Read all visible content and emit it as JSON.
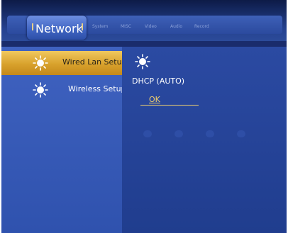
{
  "tabs": [
    {
      "label": "Network",
      "active": true
    },
    {
      "label": "System",
      "active": false
    },
    {
      "label": "MISC",
      "active": false
    },
    {
      "label": "Video",
      "active": false
    },
    {
      "label": "Audio",
      "active": false
    },
    {
      "label": "Record",
      "active": false
    }
  ],
  "sidebar": {
    "items": [
      {
        "label": "Wired Lan Setup",
        "selected": true,
        "icon": "sun-icon"
      },
      {
        "label": "Wireless Setup",
        "selected": false,
        "icon": "sun-icon"
      }
    ]
  },
  "main": {
    "icon": "sun-icon",
    "connection_mode": "DHCP (AUTO)",
    "ok_label": "OK"
  },
  "colors": {
    "background": "#1a2c6c",
    "selected_item": "#e0ad3a",
    "ok_text": "#f0cf6c",
    "text": "#ffffff"
  }
}
